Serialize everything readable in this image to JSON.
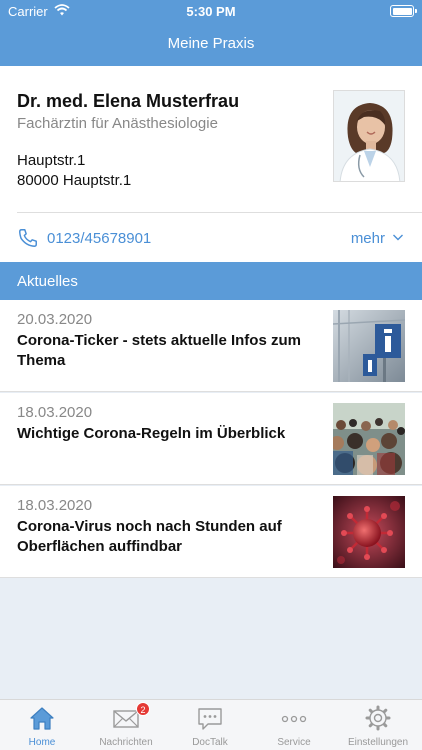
{
  "status_bar": {
    "carrier": "Carrier",
    "time": "5:30 PM"
  },
  "header": {
    "title": "Meine Praxis"
  },
  "profile": {
    "name": "Dr. med. Elena Musterfrau",
    "specialty": "Fachärztin für Anästhesiologie",
    "address_line1": "Hauptstr.1",
    "address_line2": "80000 Hauptstr.1",
    "phone": "0123/45678901",
    "more_label": "mehr"
  },
  "news_section": {
    "title": "Aktuelles",
    "items": [
      {
        "date": "20.03.2020",
        "title": "Corona-Ticker - stets aktuelle Infos zum Thema",
        "thumb": "info-sign"
      },
      {
        "date": "18.03.2020",
        "title": "Wichtige Corona-Regeln im Überblick",
        "thumb": "crowd"
      },
      {
        "date": "18.03.2020",
        "title": "Corona-Virus noch nach Stunden auf Oberflächen auffindbar",
        "thumb": "virus"
      }
    ]
  },
  "tabbar": {
    "tabs": [
      {
        "label": "Home",
        "icon": "home-icon",
        "active": true
      },
      {
        "label": "Nachrichten",
        "icon": "mail-icon",
        "badge": "2"
      },
      {
        "label": "DocTalk",
        "icon": "chat-icon"
      },
      {
        "label": "Service",
        "icon": "more-dots-icon"
      },
      {
        "label": "Einstellungen",
        "icon": "gear-icon"
      }
    ]
  },
  "colors": {
    "accent": "#5b9bd8",
    "link": "#4a8fd6",
    "badge": "#e53935"
  }
}
